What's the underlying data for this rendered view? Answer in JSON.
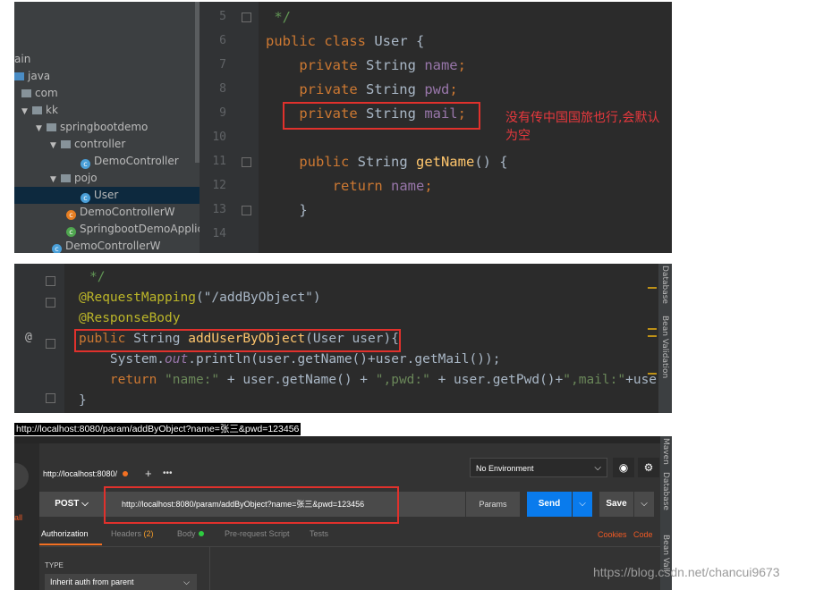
{
  "panel1": {
    "tree": {
      "items": [
        {
          "label": "ain",
          "icon": "none"
        },
        {
          "label": "java",
          "icon": "folder-blue"
        },
        {
          "label": "com",
          "icon": "package"
        },
        {
          "label": "kk",
          "icon": "package"
        },
        {
          "label": "springbootdemo",
          "icon": "package"
        },
        {
          "label": "controller",
          "icon": "package"
        },
        {
          "label": "DemoController",
          "icon": "class"
        },
        {
          "label": "pojo",
          "icon": "package"
        },
        {
          "label": "User",
          "icon": "class",
          "selected": true
        },
        {
          "label": "DemoControllerW",
          "icon": "class"
        },
        {
          "label": "SpringbootDemoApplica",
          "icon": "spring-class"
        },
        {
          "label": "DemoControllerW",
          "icon": "class"
        }
      ]
    },
    "line_numbers": [
      "5",
      "6",
      "7",
      "8",
      "9",
      "10",
      "11",
      "12",
      "13",
      "14"
    ],
    "code": [
      {
        "k": " */"
      },
      {
        "a": "public class ",
        "b": "User {"
      },
      {
        "a": "    private ",
        "b": "String ",
        "c": "name",
        "d": ";"
      },
      {
        "a": "    private ",
        "b": "String ",
        "c": "pwd",
        "d": ";"
      },
      {
        "a": "    private ",
        "b": "String ",
        "c": "mail",
        "d": ";"
      },
      {
        "a": ""
      },
      {
        "a": "    public ",
        "b": "String ",
        "m": "getName",
        "d": "() {"
      },
      {
        "a": "        return ",
        "c": "name",
        "d": ";"
      },
      {
        "d": "    }"
      },
      {
        "d": ""
      }
    ],
    "note": "没有传中国国旅也行,会默认为空"
  },
  "panel2": {
    "code": {
      "comment": "*/",
      "annotation1": "@RequestMapping",
      "annotation1_arg": "(\"/addByObject\")",
      "annotation2": "@ResponseBody",
      "sig_kw": "public ",
      "sig_type": "String ",
      "sig_name": "addUserByObject",
      "sig_rest": "(User user){",
      "line_print_a": "    System.",
      "line_print_b": "out",
      "line_print_c": ".println(user.getName()+user.getMail());",
      "line_ret_kw": "    return ",
      "line_ret_s1": "\"name:\"",
      "line_ret_m1": " + user.getName() + ",
      "line_ret_s2": "\",pwd:\"",
      "line_ret_m2": " + user.getPwd()+",
      "line_ret_s3": "\",mail:\"",
      "line_ret_m3": "+user.getMail",
      "close": "}",
      "gutter_at": "@"
    },
    "side_tabs": [
      "Database",
      "Bean Validation"
    ]
  },
  "panel3": {
    "caption": "http://localhost:8080/param/addByObject?name=张三&pwd=123456",
    "tab_label": "http://localhost:8080/",
    "environment": "No Environment",
    "method": "POST",
    "url": "http://localhost:8080/param/addByObject?name=张三&pwd=123456",
    "params_label": "Params",
    "send_label": "Send",
    "save_label": "Save",
    "left_label": "all",
    "subtabs": {
      "authorization": "Authorization",
      "headers": "Headers",
      "headers_count": "(2)",
      "body": "Body",
      "prerequest": "Pre-request Script",
      "tests": "Tests"
    },
    "cookies_label": "Cookies",
    "code_label": "Code",
    "type_label": "TYPE",
    "auth_type": "Inherit auth from parent",
    "side_tabs": [
      "Maven",
      "Database",
      "Bean Vali"
    ],
    "accent": "#f37022",
    "send_color": "#097bed"
  },
  "watermark": "https://blog.csdn.net/chancui9673"
}
